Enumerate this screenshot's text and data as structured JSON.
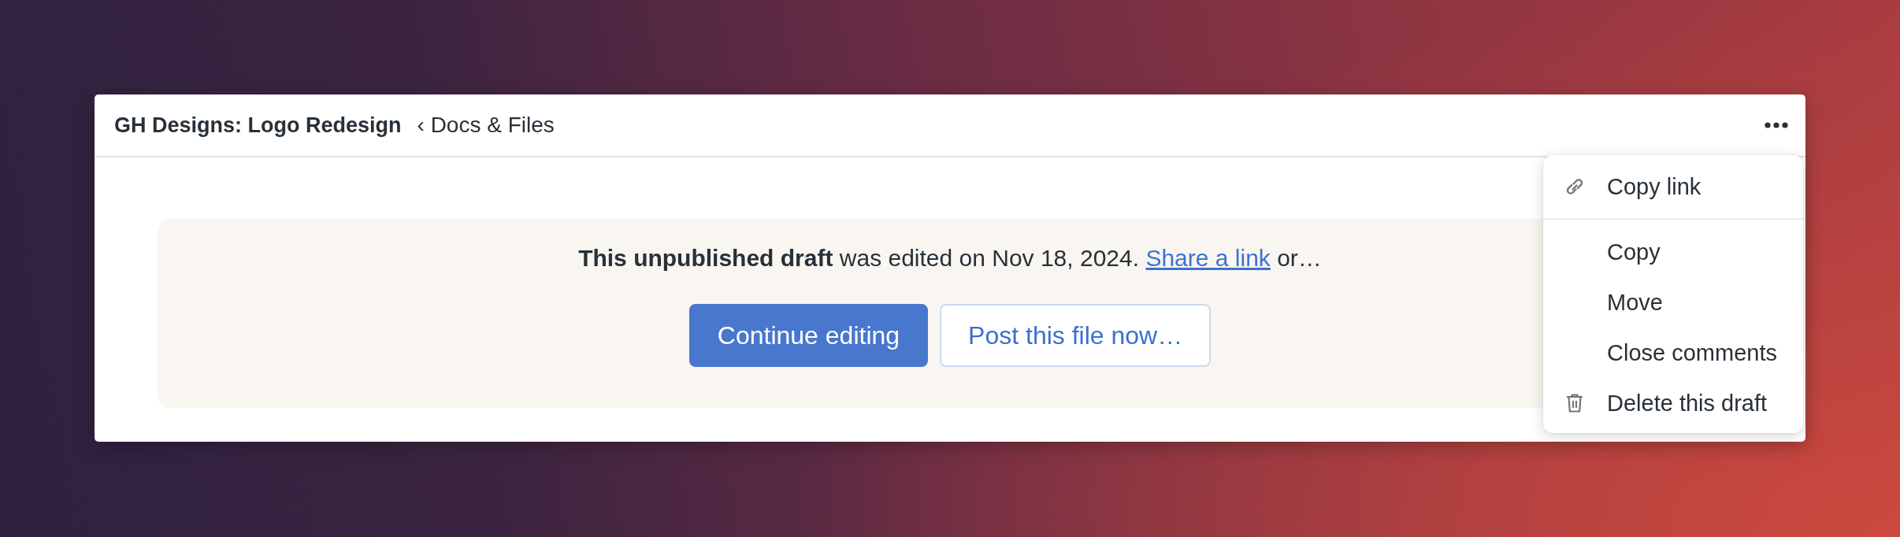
{
  "header": {
    "title": "GH Designs: Logo Redesign",
    "breadcrumb": "‹ Docs & Files"
  },
  "banner": {
    "message": "**This unpublished draft** was edited on Nov 18, 2024.",
    "link": "Share a link",
    "after": "or…",
    "buttons": [
      {
        "label": "Continue editing",
        "kind": "primary"
      },
      {
        "label": "Post this file now…",
        "kind": "secondary"
      }
    ]
  },
  "menu": {
    "groups": [
      [
        {
          "label": "Copy link",
          "kind": "link"
        }
      ],
      [
        {
          "label": "Copy",
          "kind": "plain"
        },
        {
          "label": "Move",
          "kind": "plain"
        },
        {
          "label": "Close comments",
          "kind": "plain"
        },
        {
          "label": "Delete this draft",
          "kind": "delete"
        }
      ]
    ]
  }
}
